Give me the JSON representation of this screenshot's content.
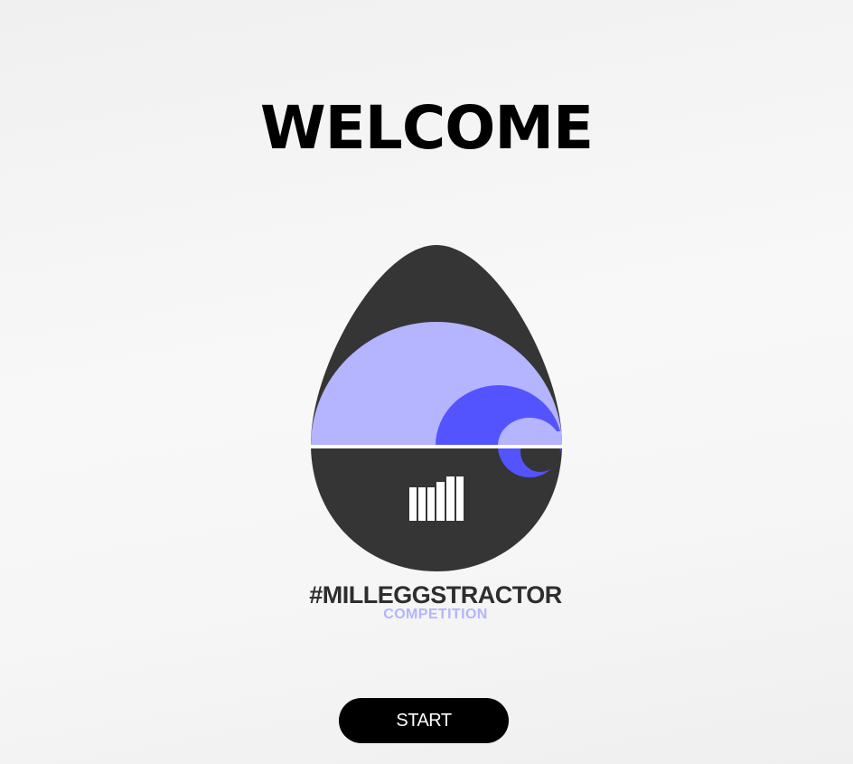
{
  "welcome": {
    "title": "WELCOME"
  },
  "logo": {
    "icon": "egg-logo-icon",
    "name": "#MILLEGGSTRACTOR",
    "subtitle": "COMPETITION",
    "colors": {
      "egg": "#353535",
      "light_purple": "#b4b4ff",
      "blue": "#5454ff",
      "white": "#ffffff"
    }
  },
  "start_button": {
    "label": "START"
  }
}
